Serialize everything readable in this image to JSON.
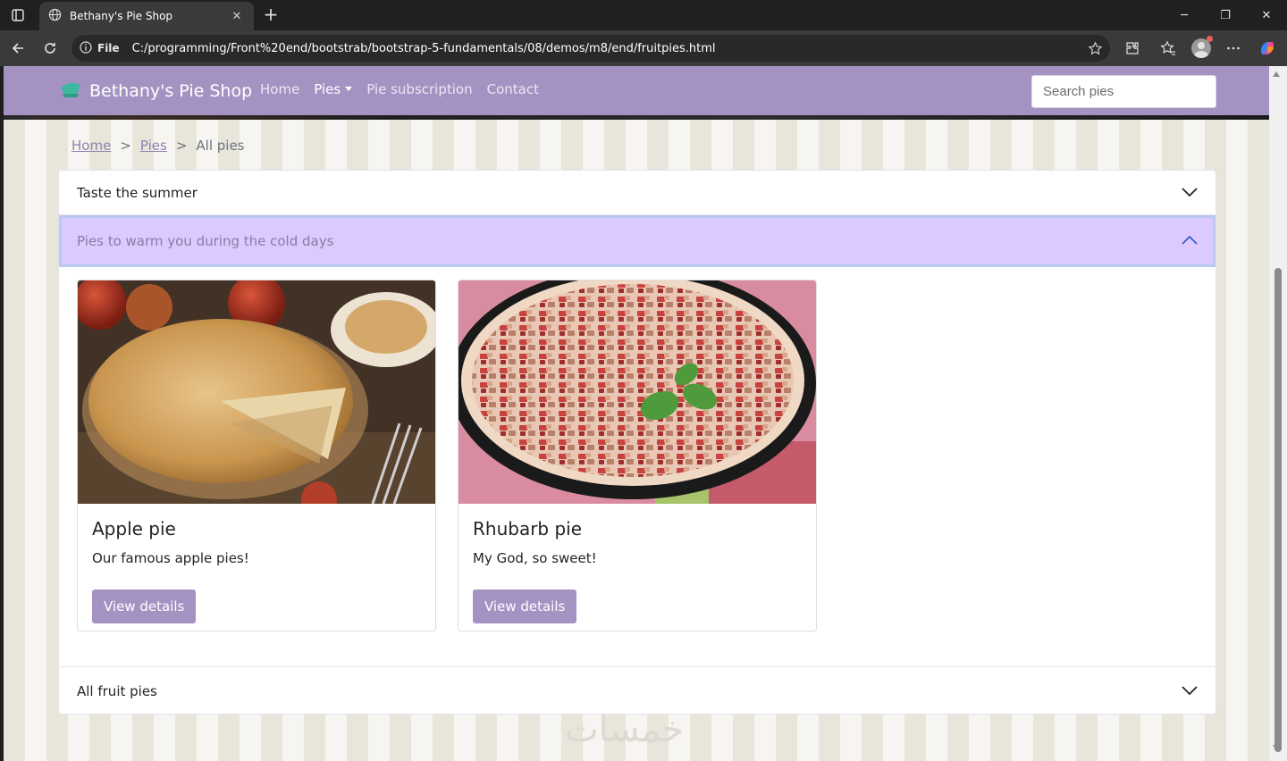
{
  "browser": {
    "tab_title": "Bethany's Pie Shop",
    "file_label": "File",
    "url": "C:/programming/Front%20end/bootstrab/bootstrap-5-fundamentals/08/demos/m8/end/fruitpies.html"
  },
  "site": {
    "brand": "Bethany's Pie Shop",
    "nav": {
      "home": "Home",
      "pies": "Pies",
      "subscription": "Pie subscription",
      "contact": "Contact"
    },
    "search_placeholder": "Search pies",
    "accent_color": "#a493c2"
  },
  "breadcrumb": {
    "home": "Home",
    "sep1": ">",
    "pies": "Pies",
    "sep2": ">",
    "current": "All pies"
  },
  "accordion": {
    "item1": "Taste the summer",
    "item2": "Pies to warm you during the cold days",
    "item3": "All fruit pies"
  },
  "cards": [
    {
      "title": "Apple pie",
      "text": "Our famous apple pies!",
      "button": "View details"
    },
    {
      "title": "Rhubarb pie",
      "text": "My God, so sweet!",
      "button": "View details"
    }
  ],
  "watermark": "خمسات"
}
